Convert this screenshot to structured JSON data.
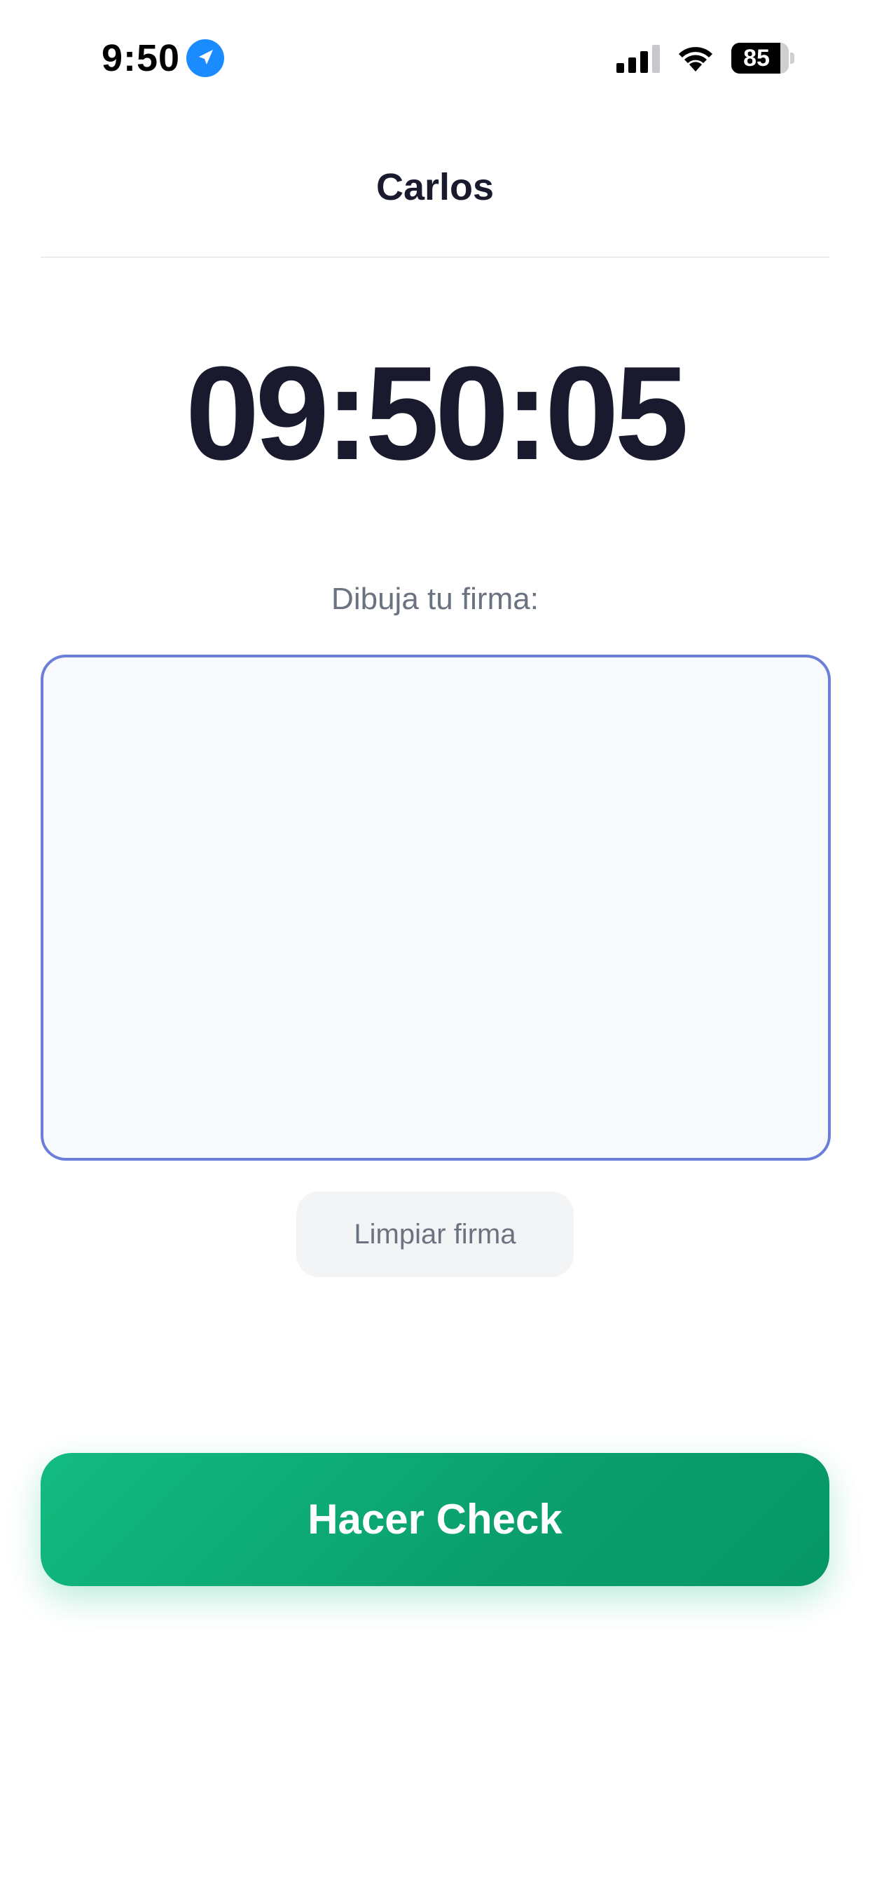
{
  "status_bar": {
    "time": "9:50",
    "battery_level": "85",
    "battery_fraction": 0.85
  },
  "icons": {
    "location": "location-arrow-icon",
    "signal": "cellular-signal-icon",
    "wifi": "wifi-icon",
    "battery": "battery-icon"
  },
  "header": {
    "title": "Carlos"
  },
  "clock": {
    "time": "09:50:05"
  },
  "signature": {
    "label": "Dibuja tu firma:",
    "clear_label": "Limpiar firma"
  },
  "actions": {
    "check_label": "Hacer Check"
  },
  "colors": {
    "accent_border": "#6b7fd8",
    "check_green": "#0a9f6d",
    "location_blue": "#1a8cff",
    "text_dark": "#1a1a2e",
    "text_muted": "#6b7280"
  }
}
